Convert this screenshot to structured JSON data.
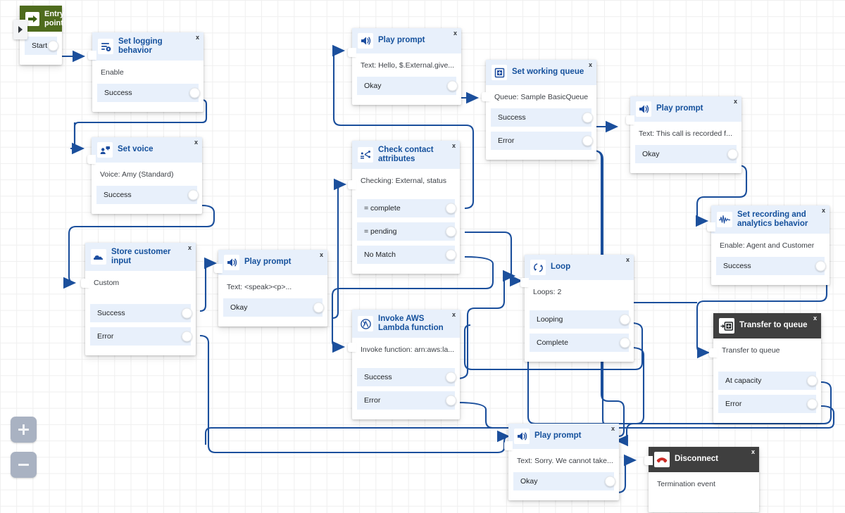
{
  "canvas": {
    "background": "#ffffff",
    "grid_color": "#efefef",
    "wire_color": "#1b4f9c",
    "accent_blue": "#14509c",
    "port_bg": "#e8f0fb",
    "dark_header": "#3f3f3f",
    "green_header": "#4e6b1d"
  },
  "zoom_controls": {
    "zoom_in_label": "+",
    "zoom_out_label": "−",
    "zoom_in_name": "zoom-in",
    "zoom_out_name": "zoom-out"
  },
  "nodes": [
    {
      "id": "entry-point",
      "title": "Entry point",
      "icon": "arrow-right-icon",
      "header_style": "green",
      "close_label": "",
      "desc": "",
      "ports": [
        {
          "label": "Start"
        }
      ]
    },
    {
      "id": "set-logging-behavior",
      "title": "Set logging behavior",
      "icon": "logging-gear-icon",
      "header_style": "light",
      "close_label": "x",
      "desc": "Enable",
      "ports": [
        {
          "label": "Success"
        }
      ]
    },
    {
      "id": "play-prompt-1",
      "title": "Play prompt",
      "icon": "speaker-icon",
      "header_style": "light",
      "close_label": "x",
      "desc": "Text: Hello, $.External.give...",
      "ports": [
        {
          "label": "Okay"
        }
      ]
    },
    {
      "id": "set-working-queue",
      "title": "Set working queue",
      "icon": "queue-plus-icon",
      "header_style": "light",
      "close_label": "x",
      "desc": "Queue: Sample BasicQueue",
      "ports": [
        {
          "label": "Success"
        },
        {
          "label": "Error"
        }
      ]
    },
    {
      "id": "play-prompt-2",
      "title": "Play prompt",
      "icon": "speaker-icon",
      "header_style": "light",
      "close_label": "x",
      "desc": "Text: This call is recorded f...",
      "ports": [
        {
          "label": "Okay"
        }
      ]
    },
    {
      "id": "set-voice",
      "title": "Set voice",
      "icon": "voice-person-icon",
      "header_style": "light",
      "close_label": "x",
      "desc": "Voice: Amy (Standard)",
      "ports": [
        {
          "label": "Success"
        }
      ]
    },
    {
      "id": "check-contact-attributes",
      "title": "Check contact attributes",
      "icon": "branch-attributes-icon",
      "header_style": "light",
      "close_label": "x",
      "desc": "Checking: External, status",
      "ports": [
        {
          "label": "= complete"
        },
        {
          "label": "= pending"
        },
        {
          "label": "No Match"
        }
      ]
    },
    {
      "id": "set-recording-and-analytics",
      "title": "Set recording and analytics behavior",
      "icon": "waveform-icon",
      "header_style": "light",
      "close_label": "x",
      "desc": "Enable: Agent and Customer",
      "ports": [
        {
          "label": "Success"
        }
      ]
    },
    {
      "id": "store-customer-input",
      "title": "Store customer input",
      "icon": "cloud-input-icon",
      "header_style": "light",
      "close_label": "x",
      "desc": "Custom",
      "ports": [
        {
          "label": "Success"
        },
        {
          "label": "Error"
        }
      ]
    },
    {
      "id": "play-prompt-3",
      "title": "Play prompt",
      "icon": "speaker-icon",
      "header_style": "light",
      "close_label": "x",
      "desc": "Text: <speak><p>...",
      "ports": [
        {
          "label": "Okay"
        }
      ]
    },
    {
      "id": "invoke-aws-lambda-function",
      "title": "Invoke AWS Lambda function",
      "icon": "lambda-icon",
      "header_style": "light",
      "close_label": "x",
      "desc": "Invoke function: arn:aws:la...",
      "ports": [
        {
          "label": "Success"
        },
        {
          "label": "Error"
        }
      ]
    },
    {
      "id": "loop",
      "title": "Loop",
      "icon": "loop-icon",
      "header_style": "light",
      "close_label": "x",
      "desc": "Loops: 2",
      "ports": [
        {
          "label": "Looping"
        },
        {
          "label": "Complete"
        }
      ]
    },
    {
      "id": "transfer-to-queue",
      "title": "Transfer to queue",
      "icon": "transfer-queue-icon",
      "header_style": "dark",
      "close_label": "x",
      "desc": "Transfer to queue",
      "ports": [
        {
          "label": "At capacity"
        },
        {
          "label": "Error"
        }
      ]
    },
    {
      "id": "play-prompt-4",
      "title": "Play prompt",
      "icon": "speaker-icon",
      "header_style": "light",
      "close_label": "x",
      "desc": "Text: Sorry. We cannot take...",
      "ports": [
        {
          "label": "Okay"
        }
      ]
    },
    {
      "id": "disconnect",
      "title": "Disconnect",
      "icon": "phone-hangup-icon",
      "header_style": "dark",
      "close_label": "x",
      "desc": "Termination event",
      "ports": []
    }
  ]
}
